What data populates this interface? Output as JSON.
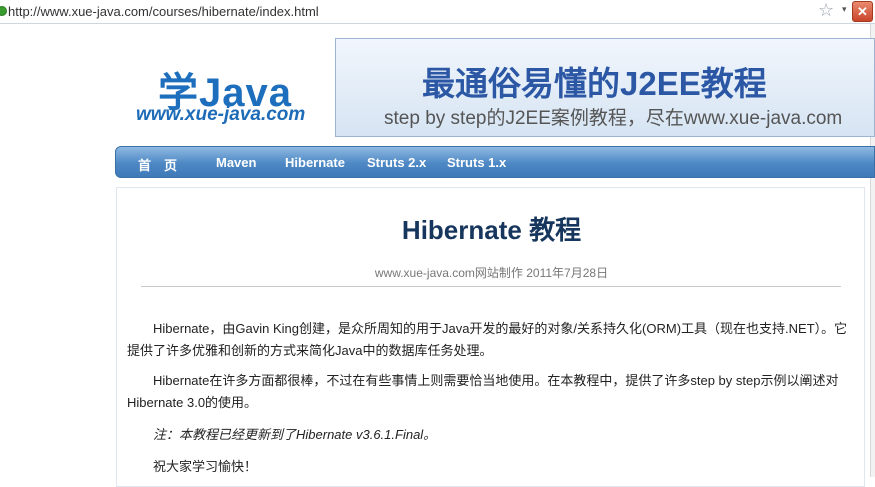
{
  "browser": {
    "url": "http://www.xue-java.com/courses/hibernate/index.html",
    "star_glyph": "☆",
    "dropdown_glyph": "▾",
    "close_glyph": "✕"
  },
  "logo": {
    "main": "学Java",
    "sub": "www.xue-java.com"
  },
  "banner": {
    "title": "最通俗易懂的J2EE教程",
    "subtitle": "step by step的J2EE案例教程，尽在www.xue-java.com"
  },
  "nav": {
    "items": [
      {
        "label": "首　页"
      },
      {
        "label": "Maven"
      },
      {
        "label": "Hibernate"
      },
      {
        "label": "Struts 2.x"
      },
      {
        "label": "Struts 1.x"
      }
    ]
  },
  "article": {
    "title": "Hibernate 教程",
    "byline": "www.xue-java.com网站制作  2011年7月28日",
    "paragraphs": [
      "Hibernate，由Gavin King创建，是众所周知的用于Java开发的最好的对象/关系持久化(ORM)工具（现在也支持.NET）。它提供了许多优雅和创新的方式来简化Java中的数据库任务处理。",
      "Hibernate在许多方面都很棒，不过在有些事情上则需要恰当地使用。在本教程中，提供了许多step by step示例以阐述对Hibernate 3.0的使用。",
      "注：本教程已经更新到了Hibernate v3.6.1.Final。",
      "祝大家学习愉快！"
    ]
  },
  "colors": {
    "nav_bg": "#4d88c4",
    "title_color": "#17365d",
    "logo_color": "#1d6fbd"
  }
}
